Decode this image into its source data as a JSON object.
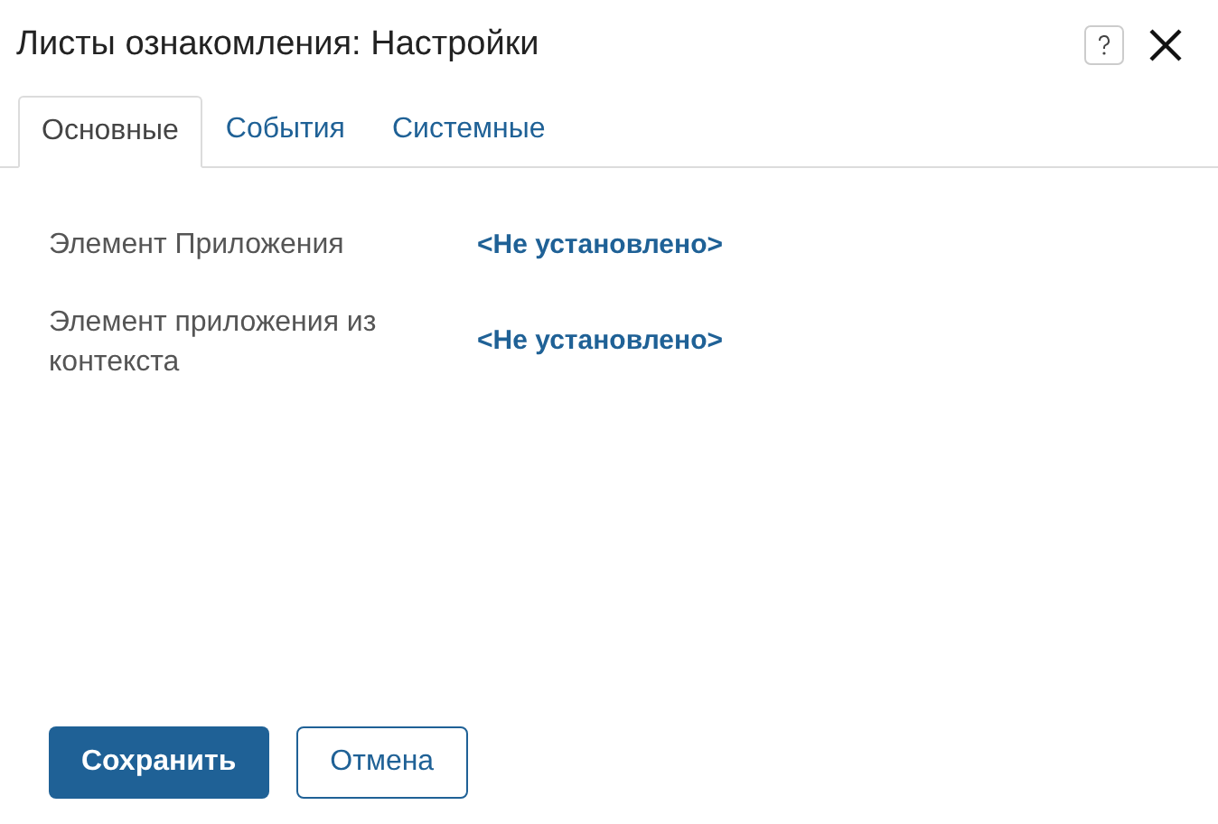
{
  "window": {
    "title": "Листы ознакомления: Настройки"
  },
  "tabs": [
    {
      "label": "Основные",
      "selected": true
    },
    {
      "label": "События",
      "selected": false
    },
    {
      "label": "Системные",
      "selected": false
    }
  ],
  "fields": [
    {
      "label": "Элемент Приложения",
      "value": "<Не установлено>"
    },
    {
      "label": "Элемент приложения из контекста",
      "value": "<Не установлено>"
    }
  ],
  "buttons": [
    {
      "label": "Сохранить",
      "kind": "primary"
    },
    {
      "label": "Отмена",
      "kind": "secondary"
    }
  ]
}
